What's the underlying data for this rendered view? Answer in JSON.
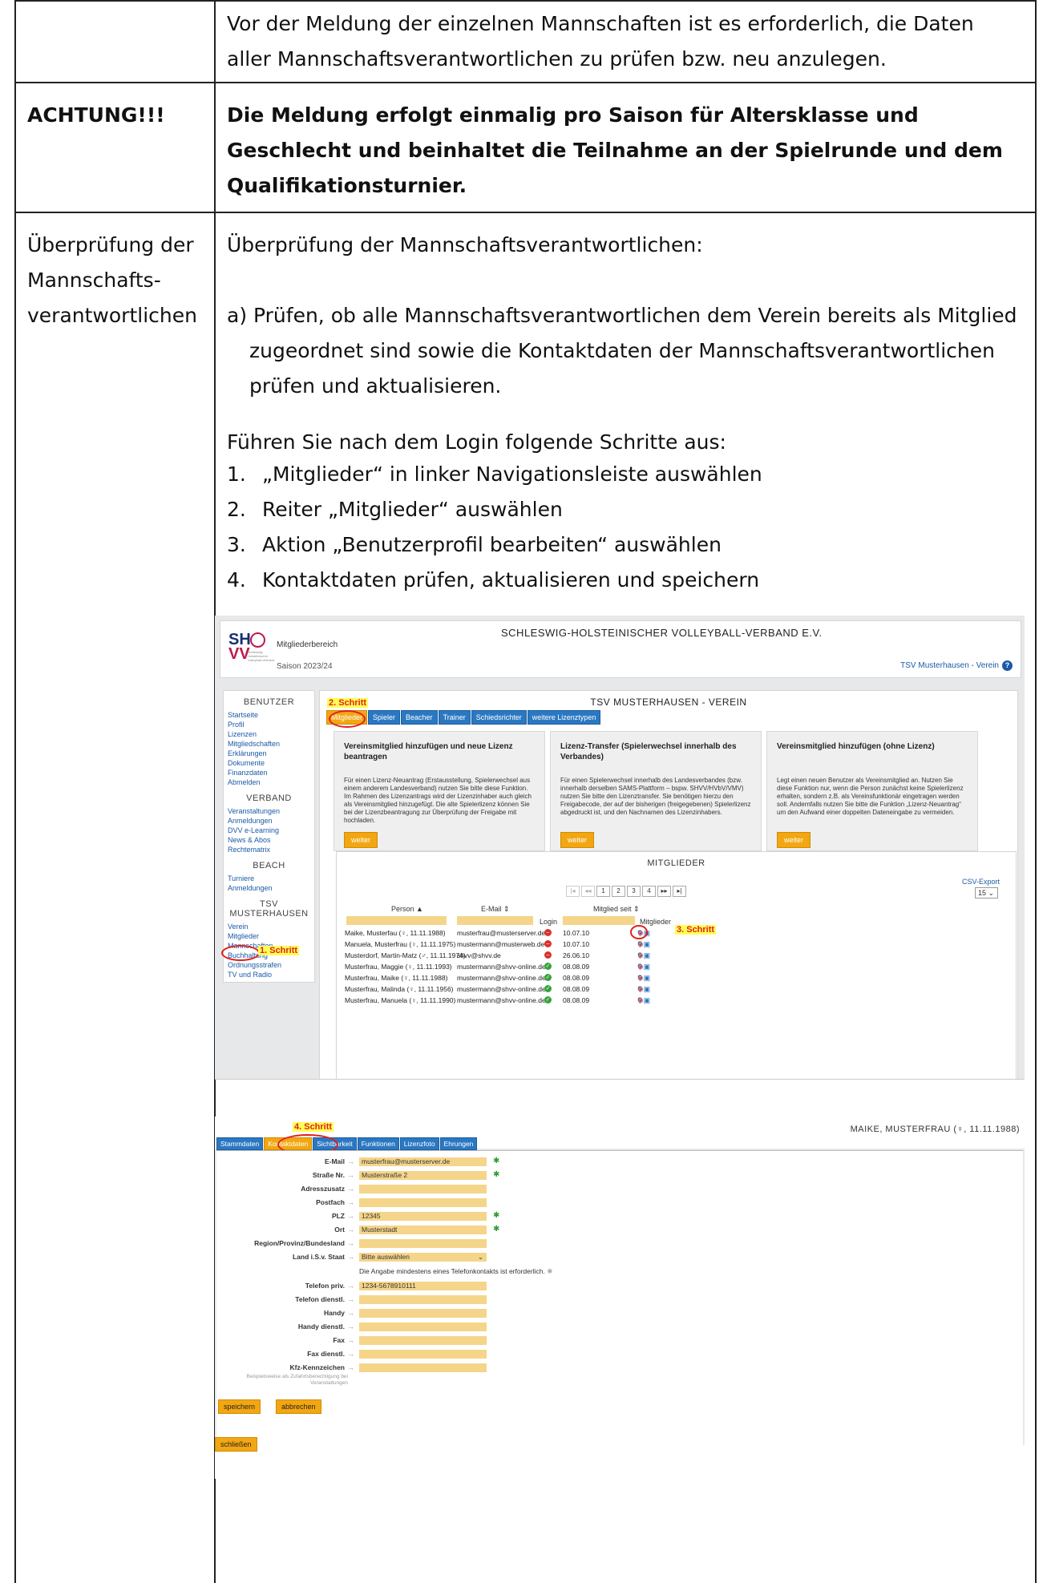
{
  "rows": [
    {
      "label": "",
      "text": "Vor der Meldung der einzelnen Mannschaften ist es erforderlich, die Daten aller Mannschaftsverantwortlichen zu prüfen bzw. neu anzulegen."
    },
    {
      "label": "ACHTUNG!!!",
      "text": "Die Meldung erfolgt einmalig pro Saison für Altersklasse und Geschlecht und beinhaltet die Teilnahme an der Spielrunde und dem Qualifikationsturnier."
    },
    {
      "label_lines": [
        "Überprüfung der",
        "Mannschafts-",
        "verantwortlichen"
      ],
      "heading": "Überprüfung der Mannschaftsverantwortlichen:",
      "point_a": "a) Prüfen, ob alle Mannschaftsverantwortlichen dem Verein bereits als Mitglied zugeordnet sind sowie die Kontaktdaten der Mannschaftsverantwortlichen prüfen und aktualisieren.",
      "steps_intro": "Führen Sie nach dem Login folgende Schritte aus:",
      "steps": [
        {
          "n": "1.",
          "text": "„Mitglieder“ in linker Navigationsleiste auswählen"
        },
        {
          "n": "2.",
          "text": "Reiter „Mitglieder“ auswählen"
        },
        {
          "n": "3.",
          "text": "Aktion „Benutzerprofil bearbeiten“ auswählen"
        },
        {
          "n": "4.",
          "text": "Kontaktdaten prüfen, aktualisieren und speichern"
        }
      ]
    }
  ],
  "screenshot1": {
    "federation": "SCHLESWIG-HOLSTEINISCHER VOLLEYBALL-VERBAND E.V.",
    "logo_sh": "SH",
    "logo_vv": "VV",
    "logo_sub": "Schleswig-Holsteinischer Volleyball-Verband",
    "area": "Mitgliederbereich",
    "season": "Saison 2023/24",
    "club_link": "TSV Musterhausen - Verein",
    "help": "?",
    "sidebar": [
      {
        "head": "BENUTZER",
        "links": [
          "Startseite",
          "Profil",
          "Lizenzen",
          "Mitgliedschaften",
          "Erklärungen",
          "Dokumente",
          "Finanzdaten",
          "Abmelden"
        ]
      },
      {
        "head": "VERBAND",
        "links": [
          "Veranstaltungen",
          "Anmeldungen",
          "DVV e-Learning",
          "News & Abos",
          "Rechtematrix"
        ]
      },
      {
        "head": "BEACH",
        "links": [
          "Turniere",
          "Anmeldungen"
        ]
      },
      {
        "head": "TSV MUSTERHAUSEN",
        "links": [
          "Verein",
          "Mitglieder",
          "Mannschaften",
          "Buchhaltung",
          "Ordnungsstrafen",
          "TV und Radio"
        ]
      }
    ],
    "main_title": "TSV MUSTERHAUSEN - VEREIN",
    "tabs": [
      "Mitglieder",
      "Spieler",
      "Beacher",
      "Trainer",
      "Schiedsrichter",
      "weitere Lizenztypen"
    ],
    "cards": [
      {
        "title": "Vereinsmitglied hinzufügen und neue Lizenz beantragen",
        "body": "Für einen Lizenz-Neuantrag (Erstausstellung, Spielerwechsel aus einem anderem Landesverband) nutzen Sie bitte diese Funktion. Im Rahmen des Lizenzantrags wird der Lizenzinhaber auch gleich als Vereinsmitglied hinzugefügt. Die alte Spielerlizenz können Sie bei der Lizenzbeantragung zur Überprüfung der Freigabe mit hochladen.",
        "button": "weiter"
      },
      {
        "title": "Lizenz-Transfer (Spielerwechsel innerhalb des Verbandes)",
        "body": "Für einen Spielerwechsel innerhalb des Landesverbandes (bzw. innerhalb derselben SAMS-Plattform – bspw. SHVV/HVbV/VMV) nutzen Sie bitte den Lizenztransfer. Sie benötigen hierzu den Freigabecode, der auf der bisherigen (freigegebenen) Spielerlizenz abgedruckt ist, und den Nachnamen des Lizenzinhabers.",
        "button": "weiter"
      },
      {
        "title": "Vereinsmitglied hinzufügen (ohne Lizenz)",
        "body": "Legt einen neuen Benutzer als Vereinsmitglied an. Nutzen Sie diese Funktion nur, wenn die Person zunächst keine Spielerlizenz erhalten, sondern z.B. als Vereinsfunktionär eingetragen werden soll. Andernfalls nutzen Sie bitte die Funktion „Lizenz-Neuantrag“ um den Aufwand einer doppelten Dateneingabe zu vermeiden.",
        "button": "weiter"
      }
    ],
    "members_title": "MITGLIEDER",
    "csv_export": "CSV-Export",
    "page_size": "15",
    "pager": [
      "|◂",
      "◂◂",
      "1",
      "2",
      "3",
      "4",
      "▸▸",
      "▸|"
    ],
    "columns": {
      "person": "Person ▲",
      "email": "E-Mail ⇕",
      "login": "Login",
      "since": "Mitglied seit ⇕",
      "member": "Mitglieder"
    },
    "members": [
      {
        "person": "Maike, Musterfau (♀, 11.11.1988)",
        "email": "musterfrau@musterserver.de",
        "login": "no",
        "since": "10.07.10"
      },
      {
        "person": "Manuela, Musterfrau (♀, 11.11.1975)",
        "email": "mustermann@musterweb.de",
        "login": "no",
        "since": "10.07.10"
      },
      {
        "person": "Musterdorf, Martin-Matz (♂, 11.11.1974)",
        "email": "shvv@shvv.de",
        "login": "no",
        "since": "26.06.10"
      },
      {
        "person": "Musterfrau, Maggie (♀, 11.11.1993)",
        "email": "mustermann@shvv-online.de",
        "login": "yes",
        "since": "08.08.09"
      },
      {
        "person": "Musterfrau, Maike (♀, 11.11.1988)",
        "email": "mustermann@shvv-online.de",
        "login": "yes",
        "since": "08.08.09"
      },
      {
        "person": "Musterfrau, Malinda (♀, 11.11.1956)",
        "email": "mustermann@shvv-online.de",
        "login": "yes",
        "since": "08.08.09"
      },
      {
        "person": "Musterfrau, Manuela (♀, 11.11.1990)",
        "email": "mustermann@shvv-online.de",
        "login": "yes",
        "since": "08.08.09"
      }
    ],
    "marks": {
      "step1": "1. Schritt",
      "step2": "2. Schritt",
      "step3": "3. Schritt"
    }
  },
  "screenshot2": {
    "person": "MAIKE, MUSTERFRAU (♀, 11.11.1988)",
    "step4": "4. Schritt",
    "tabs": [
      "Stammdaten",
      "Kontaktdaten",
      "Sichtbarkeit",
      "Funktionen",
      "Lizenzfoto",
      "Ehrungen"
    ],
    "fields": [
      {
        "label": "E-Mail",
        "value": "musterfrau@musterserver.de",
        "required": true
      },
      {
        "label": "Straße Nr.",
        "value": "Musterstraße 2",
        "required": true
      },
      {
        "label": "Adresszusatz",
        "value": "",
        "required": false
      },
      {
        "label": "Postfach",
        "value": "",
        "required": false
      },
      {
        "label": "PLZ",
        "value": "12345",
        "required": true
      },
      {
        "label": "Ort",
        "value": "Musterstadt",
        "required": true
      },
      {
        "label": "Region/Provinz/Bundesland",
        "value": "",
        "required": false
      },
      {
        "label": "Land i.S.v. Staat",
        "value": "Bitte auswählen",
        "required": false
      }
    ],
    "phone_note": "Die Angabe mindestens eines Telefonkontakts ist erforderlich.",
    "fields2": [
      {
        "label": "Telefon priv.",
        "value": "1234-5678910111"
      },
      {
        "label": "Telefon dienstl.",
        "value": ""
      },
      {
        "label": "Handy",
        "value": ""
      },
      {
        "label": "Handy dienstl.",
        "value": ""
      },
      {
        "label": "Fax",
        "value": ""
      },
      {
        "label": "Fax dienstl.",
        "value": ""
      },
      {
        "label": "Kfz-Kennzeichen",
        "value": ""
      }
    ],
    "kfz_hint": "Beispielsweise als Zufahrtsberechtigung bei Veranstaltungen",
    "save": "speichern",
    "cancel": "abbrechen",
    "close": "schließen"
  }
}
